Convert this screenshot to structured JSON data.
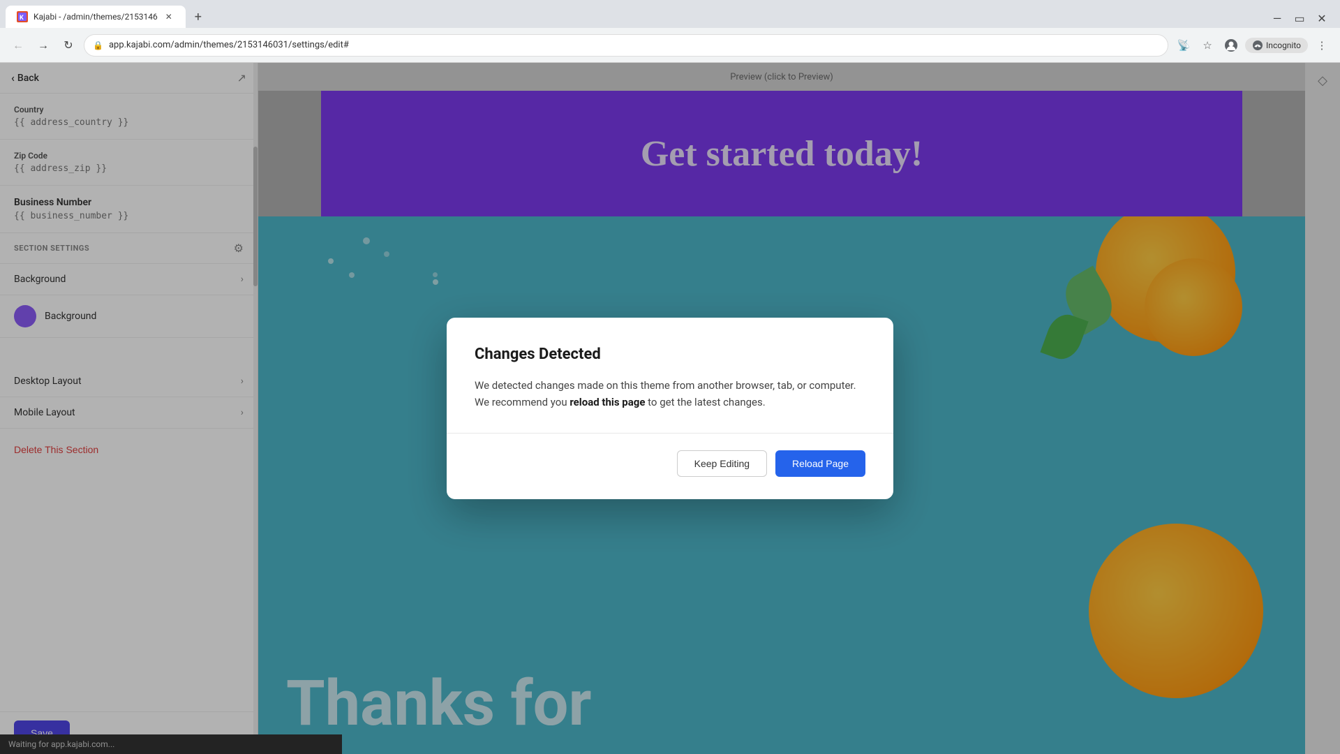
{
  "browser": {
    "tab_title": "Kajabi - /admin/themes/2153146",
    "tab_favicon": "K",
    "url": "app.kajabi.com/admin/themes/2153146031/settings/edit#",
    "incognito_label": "Incognito"
  },
  "sidebar": {
    "back_label": "Back",
    "fields": [
      {
        "label": "Country",
        "value": "{{ address_country }}"
      },
      {
        "label": "Zip Code",
        "value": "{{ address_zip }}"
      },
      {
        "label": "Business Number",
        "value": "{{ business_number }}"
      }
    ],
    "section_settings_label": "SECTION SETTINGS",
    "background_collapse_label": "Background",
    "background_color_label": "Background",
    "background_color_hex": "#8B5CF6",
    "desktop_layout_label": "Desktop Layout",
    "mobile_layout_label": "Mobile Layout",
    "delete_section_label": "Delete This Section",
    "save_label": "Save"
  },
  "modal": {
    "title": "Changes Detected",
    "body_text": "We detected changes made on this theme from another browser, tab, or computer. We recommend you ",
    "body_bold": "reload this page",
    "body_text2": " to get the latest changes.",
    "keep_editing_label": "Keep Editing",
    "reload_label": "Reload Page"
  },
  "preview": {
    "header_text": "Preview (click to Preview)",
    "purple_text": "Get started today!",
    "thanks_text": "Thanks for"
  },
  "status": {
    "text": "Waiting for app.kajabi.com..."
  }
}
